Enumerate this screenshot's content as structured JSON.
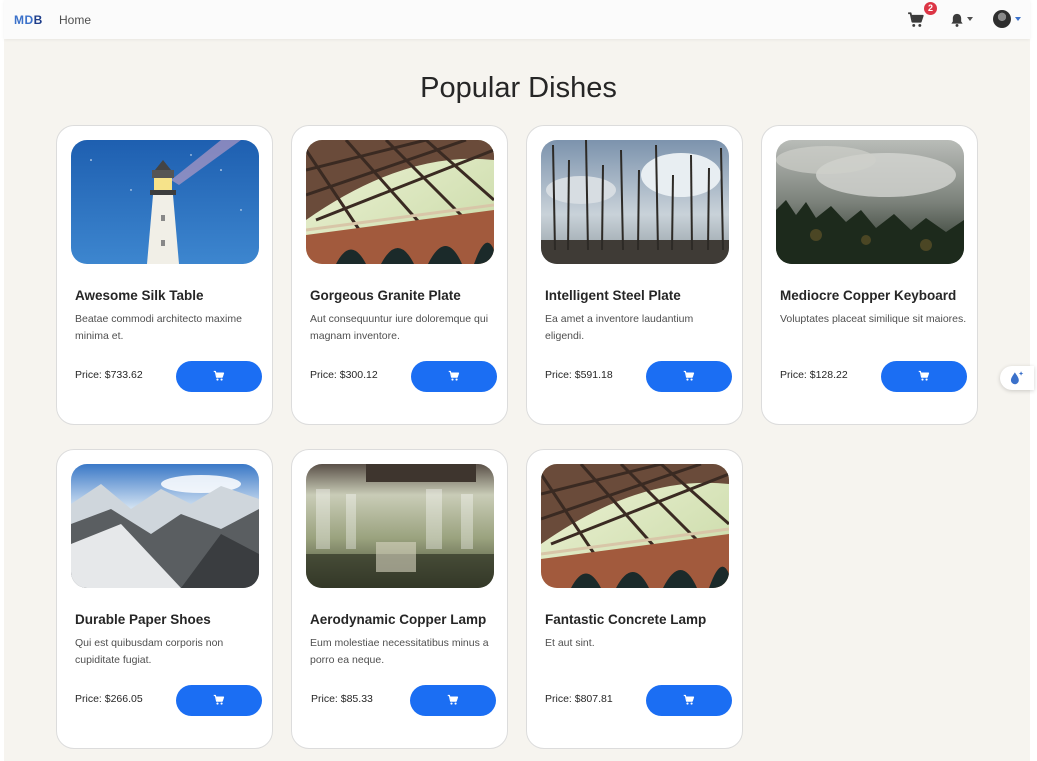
{
  "navbar": {
    "brand_part1": "MD",
    "brand_part2": "B",
    "home_label": "Home",
    "cart_count": "2",
    "icons": [
      "cart-icon",
      "bell-icon",
      "avatar"
    ]
  },
  "page_title": "Popular Dishes",
  "accent_color": "#1b6ef3",
  "cards": [
    {
      "title": "Awesome Silk Table",
      "desc": "Beatae commodi architecto maxime minima et.",
      "price": "Price: $733.62",
      "image": "lighthouse"
    },
    {
      "title": "Gorgeous Granite Plate",
      "desc": "Aut consequuntur iure doloremque qui magnam inventore.",
      "price": "Price: $300.12",
      "image": "bridge"
    },
    {
      "title": "Intelligent Steel Plate",
      "desc": "Ea amet a inventore laudantium eligendi.",
      "price": "Price: $591.18",
      "image": "dead-forest"
    },
    {
      "title": "Mediocre Copper Keyboard",
      "desc": "Voluptates placeat similique sit maiores.",
      "price": "Price: $128.22",
      "image": "misty-forest"
    },
    {
      "title": "Durable Paper Shoes",
      "desc": "Qui est quibusdam corporis non cupiditate fugiat.",
      "price": "Price: $266.05",
      "image": "snowy-mountains"
    },
    {
      "title": "Aerodynamic Copper Lamp",
      "desc": "Eum molestiae necessitatibus minus a porro ea neque.",
      "price": "Price: $85.33",
      "image": "blurred-interior"
    },
    {
      "title": "Fantastic Concrete Lamp",
      "desc": "Et aut sint.",
      "price": "Price: $807.81",
      "image": "bridge"
    }
  ]
}
